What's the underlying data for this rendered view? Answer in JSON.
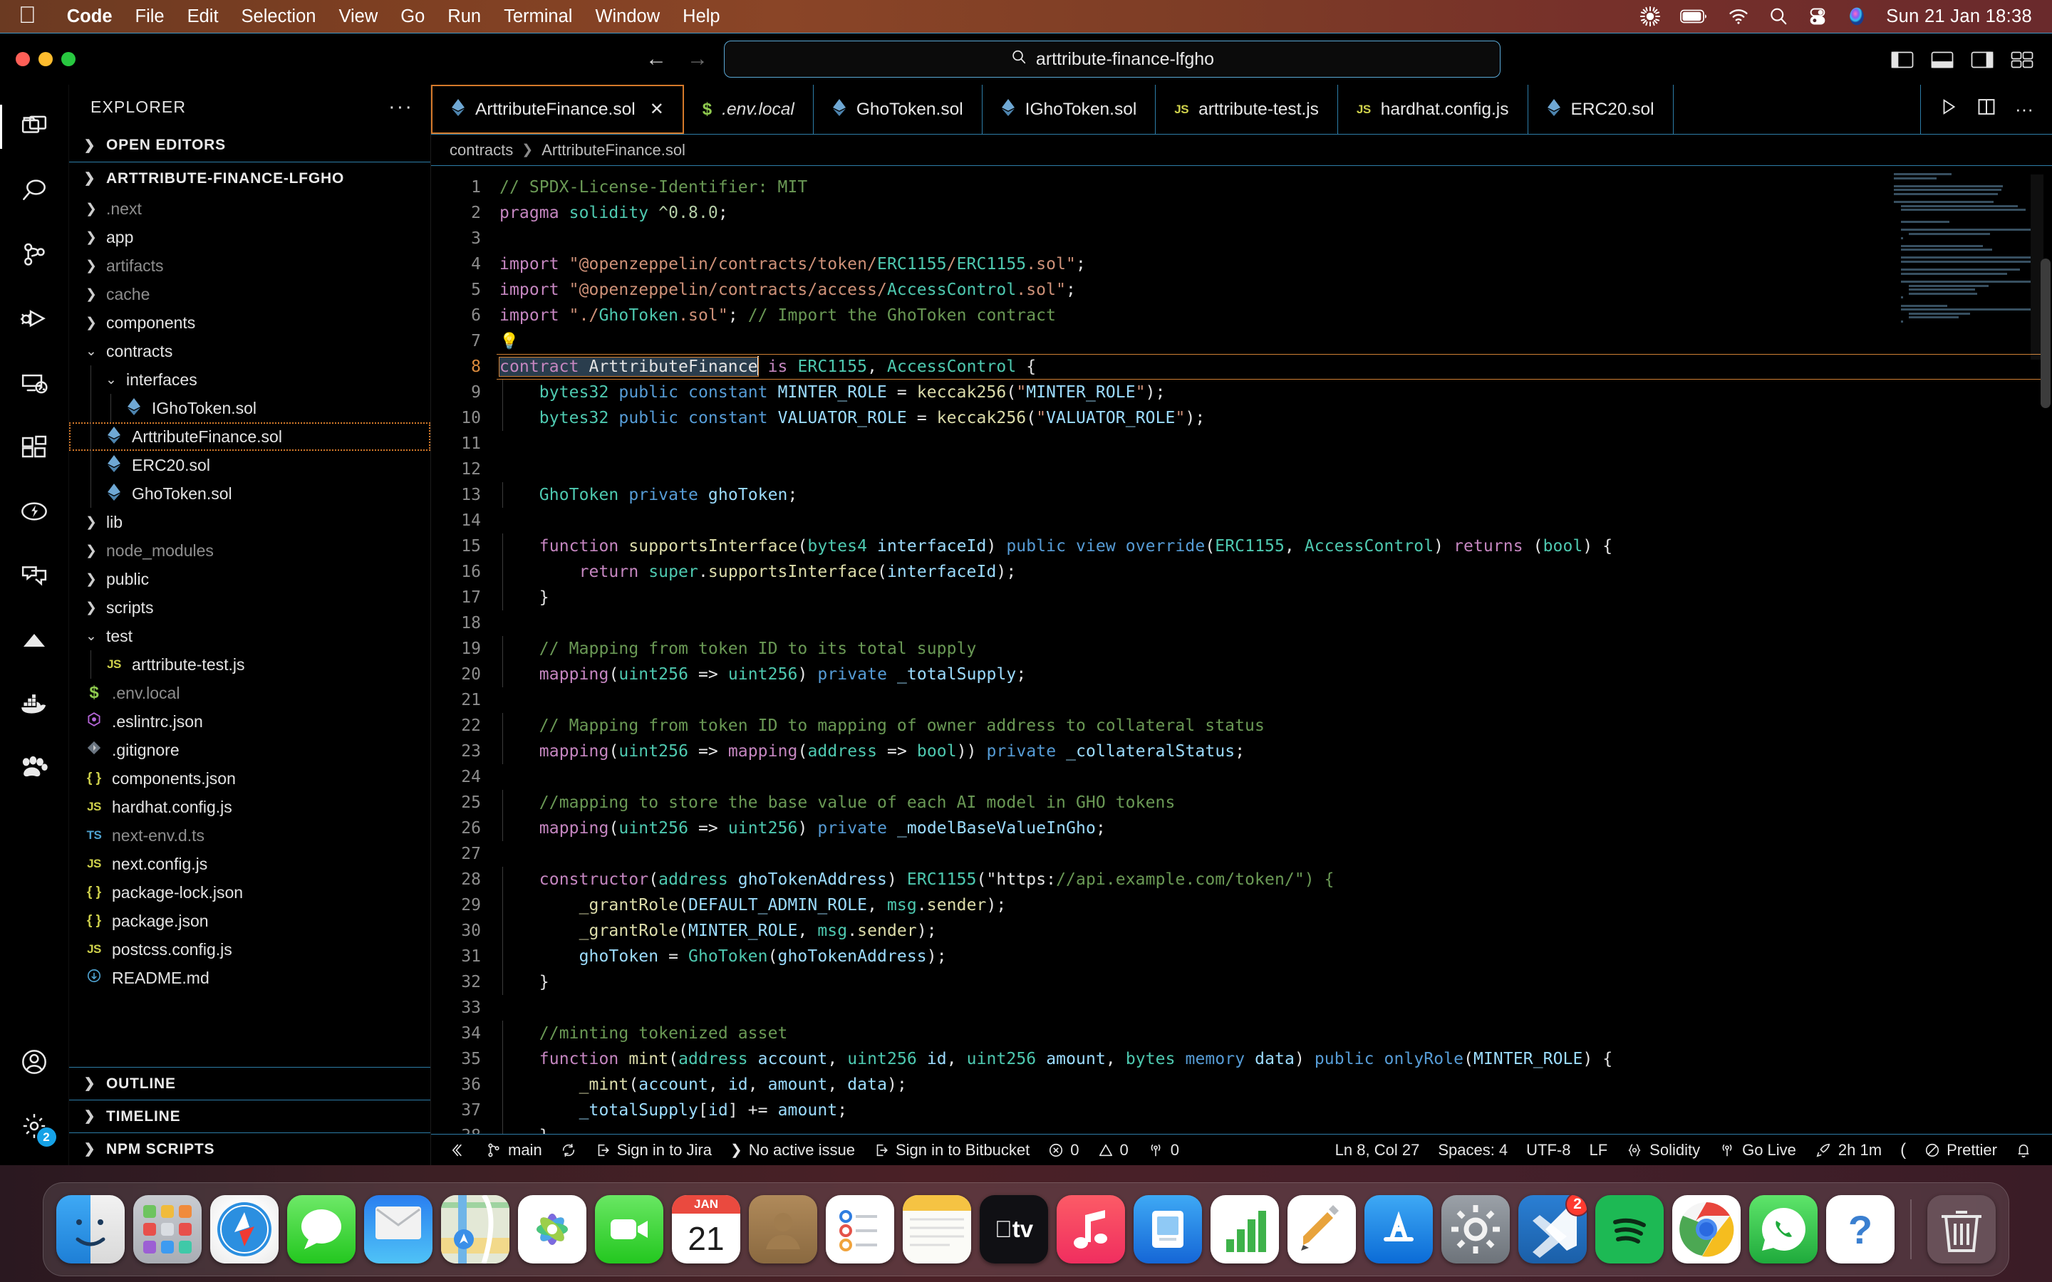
{
  "menubar": {
    "apple_icon": "apple-logo-icon",
    "items": [
      "Code",
      "File",
      "Edit",
      "Selection",
      "View",
      "Go",
      "Run",
      "Terminal",
      "Window",
      "Help"
    ],
    "tray_icons": [
      "brightness-icon",
      "battery-icon",
      "wifi-icon",
      "search-icon",
      "control-center-icon",
      "siri-icon"
    ],
    "clock": "Sun 21 Jan  18:38"
  },
  "titlebar": {
    "back_arrow": "←",
    "forward_arrow": "→",
    "search_icon": "search-icon",
    "command_center_value": "arttribute-finance-lfgho",
    "layout_icons": [
      "toggle-primary-sidebar-icon",
      "toggle-panel-icon",
      "toggle-secondary-sidebar-icon",
      "customize-layout-icon"
    ]
  },
  "activitybar": {
    "items": [
      {
        "name": "explorer",
        "icon": "files-icon",
        "active": true
      },
      {
        "name": "search",
        "icon": "search-icon",
        "active": false
      },
      {
        "name": "source-control",
        "icon": "source-control-icon",
        "active": false
      },
      {
        "name": "run-and-debug",
        "icon": "debug-icon",
        "active": false
      },
      {
        "name": "remote-explorer",
        "icon": "remote-explorer-icon",
        "active": false
      },
      {
        "name": "extensions",
        "icon": "extensions-icon",
        "active": false
      },
      {
        "name": "thunder-client",
        "icon": "lightning-icon",
        "active": false
      },
      {
        "name": "chat",
        "icon": "chat-icon",
        "active": false
      },
      {
        "name": "vercel",
        "icon": "triangle-icon",
        "active": false
      },
      {
        "name": "docker",
        "icon": "docker-whale-icon",
        "active": false
      },
      {
        "name": "test-explorer",
        "icon": "beaker-icon",
        "active": false
      }
    ],
    "bottom": [
      {
        "name": "accounts",
        "icon": "account-icon",
        "badge": ""
      },
      {
        "name": "settings",
        "icon": "gear-icon",
        "badge": "2"
      }
    ]
  },
  "sidebar": {
    "title": "EXPLORER",
    "more_actions": "···",
    "sections": {
      "open_editors": "OPEN EDITORS",
      "workspace": "ARTTRIBUTE-FINANCE-LFGHO",
      "outline": "OUTLINE",
      "timeline": "TIMELINE",
      "npm_scripts": "NPM SCRIPTS"
    },
    "tree": [
      {
        "label": ".next",
        "type": "folder",
        "expanded": false,
        "indent": 1,
        "dim": true
      },
      {
        "label": "app",
        "type": "folder",
        "expanded": false,
        "indent": 1,
        "dim": false
      },
      {
        "label": "artifacts",
        "type": "folder",
        "expanded": false,
        "indent": 1,
        "dim": true
      },
      {
        "label": "cache",
        "type": "folder",
        "expanded": false,
        "indent": 1,
        "dim": true
      },
      {
        "label": "components",
        "type": "folder",
        "expanded": false,
        "indent": 1,
        "dim": false
      },
      {
        "label": "contracts",
        "type": "folder",
        "expanded": true,
        "indent": 1,
        "dim": false
      },
      {
        "label": "interfaces",
        "type": "folder",
        "expanded": true,
        "indent": 2,
        "dim": false
      },
      {
        "label": "IGhoToken.sol",
        "type": "sol",
        "indent": 3,
        "dim": false
      },
      {
        "label": "ArttributeFinance.sol",
        "type": "sol",
        "indent": 2,
        "dim": false,
        "focused": true
      },
      {
        "label": "ERC20.sol",
        "type": "sol",
        "indent": 2,
        "dim": false
      },
      {
        "label": "GhoToken.sol",
        "type": "sol",
        "indent": 2,
        "dim": false
      },
      {
        "label": "lib",
        "type": "folder",
        "expanded": false,
        "indent": 1,
        "dim": false
      },
      {
        "label": "node_modules",
        "type": "folder",
        "expanded": false,
        "indent": 1,
        "dim": true
      },
      {
        "label": "public",
        "type": "folder",
        "expanded": false,
        "indent": 1,
        "dim": false
      },
      {
        "label": "scripts",
        "type": "folder",
        "expanded": false,
        "indent": 1,
        "dim": false
      },
      {
        "label": "test",
        "type": "folder",
        "expanded": true,
        "indent": 1,
        "dim": false
      },
      {
        "label": "arttribute-test.js",
        "type": "js",
        "indent": 2,
        "dim": false
      },
      {
        "label": ".env.local",
        "type": "env",
        "indent": 1,
        "dim": true
      },
      {
        "label": ".eslintrc.json",
        "type": "eslint",
        "indent": 1,
        "dim": false
      },
      {
        "label": ".gitignore",
        "type": "git",
        "indent": 1,
        "dim": false
      },
      {
        "label": "components.json",
        "type": "json",
        "indent": 1,
        "dim": false
      },
      {
        "label": "hardhat.config.js",
        "type": "js",
        "indent": 1,
        "dim": false
      },
      {
        "label": "next-env.d.ts",
        "type": "ts",
        "indent": 1,
        "dim": true
      },
      {
        "label": "next.config.js",
        "type": "js",
        "indent": 1,
        "dim": false
      },
      {
        "label": "package-lock.json",
        "type": "json",
        "indent": 1,
        "dim": false
      },
      {
        "label": "package.json",
        "type": "json",
        "indent": 1,
        "dim": false
      },
      {
        "label": "postcss.config.js",
        "type": "js",
        "indent": 1,
        "dim": false
      },
      {
        "label": "README.md",
        "type": "md",
        "indent": 1,
        "dim": false
      }
    ]
  },
  "tabs": [
    {
      "label": "ArttributeFinance.sol",
      "icon": "solidity-icon",
      "active": true,
      "closable": true,
      "italic": false
    },
    {
      "label": ".env.local",
      "icon": "env-icon",
      "active": false,
      "closable": false,
      "italic": true
    },
    {
      "label": "GhoToken.sol",
      "icon": "solidity-icon",
      "active": false,
      "closable": false,
      "italic": false
    },
    {
      "label": "IGhoToken.sol",
      "icon": "solidity-icon",
      "active": false,
      "closable": false,
      "italic": false
    },
    {
      "label": "arttribute-test.js",
      "icon": "js-icon",
      "active": false,
      "closable": false,
      "italic": false
    },
    {
      "label": "hardhat.config.js",
      "icon": "js-icon",
      "active": false,
      "closable": false,
      "italic": false
    },
    {
      "label": "ERC20.sol",
      "icon": "solidity-icon",
      "active": false,
      "closable": false,
      "italic": false
    }
  ],
  "tab_actions": [
    "run-icon",
    "split-editor-icon",
    "more-actions-icon"
  ],
  "breadcrumb": [
    "contracts",
    "ArttributeFinance.sol"
  ],
  "editor": {
    "close_label": "✕",
    "total_lines_visible": 38,
    "current_line": 8,
    "lines": [
      {
        "n": 1,
        "text": "// SPDX-License-Identifier: MIT"
      },
      {
        "n": 2,
        "text": "pragma solidity ^0.8.0;"
      },
      {
        "n": 3,
        "text": ""
      },
      {
        "n": 4,
        "text": "import \"@openzeppelin/contracts/token/ERC1155/ERC1155.sol\";"
      },
      {
        "n": 5,
        "text": "import \"@openzeppelin/contracts/access/AccessControl.sol\";"
      },
      {
        "n": 6,
        "text": "import \"./GhoToken.sol\"; // Import the GhoToken contract"
      },
      {
        "n": 7,
        "text": ""
      },
      {
        "n": 8,
        "text": "contract ArttributeFinance is ERC1155, AccessControl {"
      },
      {
        "n": 9,
        "text": "    bytes32 public constant MINTER_ROLE = keccak256(\"MINTER_ROLE\");"
      },
      {
        "n": 10,
        "text": "    bytes32 public constant VALUATOR_ROLE = keccak256(\"VALUATOR_ROLE\");"
      },
      {
        "n": 11,
        "text": ""
      },
      {
        "n": 12,
        "text": ""
      },
      {
        "n": 13,
        "text": "    GhoToken private ghoToken;"
      },
      {
        "n": 14,
        "text": ""
      },
      {
        "n": 15,
        "text": "    function supportsInterface(bytes4 interfaceId) public view override(ERC1155, AccessControl) returns (bool) {"
      },
      {
        "n": 16,
        "text": "        return super.supportsInterface(interfaceId);"
      },
      {
        "n": 17,
        "text": "    }"
      },
      {
        "n": 18,
        "text": ""
      },
      {
        "n": 19,
        "text": "    // Mapping from token ID to its total supply"
      },
      {
        "n": 20,
        "text": "    mapping(uint256 => uint256) private _totalSupply;"
      },
      {
        "n": 21,
        "text": ""
      },
      {
        "n": 22,
        "text": "    // Mapping from token ID to mapping of owner address to collateral status"
      },
      {
        "n": 23,
        "text": "    mapping(uint256 => mapping(address => bool)) private _collateralStatus;"
      },
      {
        "n": 24,
        "text": ""
      },
      {
        "n": 25,
        "text": "    //mapping to store the base value of each AI model in GHO tokens"
      },
      {
        "n": 26,
        "text": "    mapping(uint256 => uint256) private _modelBaseValueInGho;"
      },
      {
        "n": 27,
        "text": ""
      },
      {
        "n": 28,
        "text": "    constructor(address ghoTokenAddress) ERC1155(\"https://api.example.com/token/\") {"
      },
      {
        "n": 29,
        "text": "        _grantRole(DEFAULT_ADMIN_ROLE, msg.sender);"
      },
      {
        "n": 30,
        "text": "        _grantRole(MINTER_ROLE, msg.sender);"
      },
      {
        "n": 31,
        "text": "        ghoToken = GhoToken(ghoTokenAddress);"
      },
      {
        "n": 32,
        "text": "    }"
      },
      {
        "n": 33,
        "text": ""
      },
      {
        "n": 34,
        "text": "    //minting tokenized asset"
      },
      {
        "n": 35,
        "text": "    function mint(address account, uint256 id, uint256 amount, bytes memory data) public onlyRole(MINTER_ROLE) {"
      },
      {
        "n": 36,
        "text": "        _mint(account, id, amount, data);"
      },
      {
        "n": 37,
        "text": "        _totalSupply[id] += amount;"
      },
      {
        "n": 38,
        "text": "    }"
      }
    ],
    "lightbulb_line": 7,
    "selection_text": "contract ArttributeFinance"
  },
  "statusbar": {
    "left": [
      {
        "name": "remote-window",
        "icon": "remote-icon",
        "label": ""
      },
      {
        "name": "branch",
        "icon": "git-branch-icon",
        "label": "main"
      },
      {
        "name": "sync",
        "icon": "sync-icon",
        "label": ""
      },
      {
        "name": "jira",
        "icon": "jira-signin-icon",
        "label": "Sign in to Jira"
      },
      {
        "name": "active-issue",
        "icon": "chevron-right-icon",
        "label": "No active issue"
      },
      {
        "name": "bitbucket",
        "icon": "bitbucket-signin-icon",
        "label": "Sign in to Bitbucket"
      },
      {
        "name": "errors",
        "icon": "error-icon",
        "label": "0"
      },
      {
        "name": "warnings",
        "icon": "warning-icon",
        "label": "0"
      },
      {
        "name": "ports",
        "icon": "radio-tower-icon",
        "label": "0"
      }
    ],
    "right": [
      {
        "name": "cursor-position",
        "icon": "",
        "label": "Ln 8, Col 27"
      },
      {
        "name": "indentation",
        "icon": "",
        "label": "Spaces: 4"
      },
      {
        "name": "encoding",
        "icon": "",
        "label": "UTF-8"
      },
      {
        "name": "eol",
        "icon": "",
        "label": "LF"
      },
      {
        "name": "language-mode",
        "icon": "solidity-brace-icon",
        "label": "Solidity"
      },
      {
        "name": "go-live",
        "icon": "broadcast-icon",
        "label": "Go Live"
      },
      {
        "name": "wakatime",
        "icon": "rocket-icon",
        "label": "2h 1m"
      },
      {
        "name": "bracket",
        "icon": "paren-icon",
        "label": ""
      },
      {
        "name": "prettier",
        "icon": "prettier-icon",
        "label": "Prettier"
      },
      {
        "name": "notifications",
        "icon": "bell-icon",
        "label": ""
      }
    ]
  },
  "dock": {
    "items": [
      {
        "name": "finder",
        "label": "Finder",
        "running": true
      },
      {
        "name": "launchpad",
        "label": "Launchpad",
        "running": false
      },
      {
        "name": "safari",
        "label": "Safari",
        "running": false
      },
      {
        "name": "messages",
        "label": "Messages",
        "running": false
      },
      {
        "name": "mail",
        "label": "Mail",
        "running": false
      },
      {
        "name": "maps",
        "label": "Maps",
        "running": false
      },
      {
        "name": "photos",
        "label": "Photos",
        "running": false
      },
      {
        "name": "facetime",
        "label": "FaceTime",
        "running": false
      },
      {
        "name": "calendar",
        "label": "Calendar",
        "running": false,
        "badge_month": "JAN",
        "badge_day": "21"
      },
      {
        "name": "contacts",
        "label": "Contacts",
        "running": false
      },
      {
        "name": "reminders",
        "label": "Reminders",
        "running": false
      },
      {
        "name": "notes",
        "label": "Notes",
        "running": true
      },
      {
        "name": "apple-tv",
        "label": "TV",
        "running": false
      },
      {
        "name": "music",
        "label": "Music",
        "running": false
      },
      {
        "name": "app-store-ipad",
        "label": "Freeform",
        "running": false
      },
      {
        "name": "numbers",
        "label": "Numbers",
        "running": false
      },
      {
        "name": "notability",
        "label": "Notability",
        "running": false
      },
      {
        "name": "app-store",
        "label": "App Store",
        "running": false
      },
      {
        "name": "system-settings",
        "label": "System Settings",
        "running": false
      },
      {
        "name": "vscode",
        "label": "Visual Studio Code",
        "running": true,
        "badge": "2"
      },
      {
        "name": "spotify",
        "label": "Spotify",
        "running": false
      },
      {
        "name": "chrome",
        "label": "Google Chrome",
        "running": true
      },
      {
        "name": "whatsapp",
        "label": "WhatsApp",
        "running": false
      },
      {
        "name": "help",
        "label": "Help",
        "running": false
      },
      {
        "name": "trash",
        "label": "Trash",
        "running": false
      }
    ],
    "calendar_month": "JAN",
    "calendar_day": "21"
  },
  "colors": {
    "accent_orange": "#d4792a",
    "tab_border": "#2d7da8",
    "solidity_icon": "#6fa8d4",
    "js_icon": "#cfd14b",
    "menubar_gradient_start": "#6b3a22",
    "menubar_gradient_end": "#6a2a2c"
  }
}
